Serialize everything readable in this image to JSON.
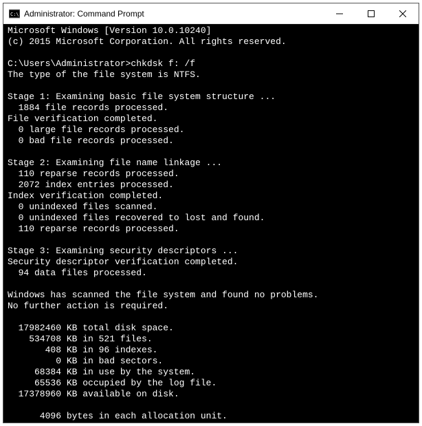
{
  "titlebar": {
    "title": "Administrator: Command Prompt"
  },
  "console": {
    "lines": [
      "Microsoft Windows [Version 10.0.10240]",
      "(c) 2015 Microsoft Corporation. All rights reserved.",
      "",
      "C:\\Users\\Administrator>chkdsk f: /f",
      "The type of the file system is NTFS.",
      "",
      "Stage 1: Examining basic file system structure ...",
      "  1884 file records processed.",
      "File verification completed.",
      "  0 large file records processed.",
      "  0 bad file records processed.",
      "",
      "Stage 2: Examining file name linkage ...",
      "  110 reparse records processed.",
      "  2072 index entries processed.",
      "Index verification completed.",
      "  0 unindexed files scanned.",
      "  0 unindexed files recovered to lost and found.",
      "  110 reparse records processed.",
      "",
      "Stage 3: Examining security descriptors ...",
      "Security descriptor verification completed.",
      "  94 data files processed.",
      "",
      "Windows has scanned the file system and found no problems.",
      "No further action is required.",
      "",
      "  17982460 KB total disk space.",
      "    534708 KB in 521 files.",
      "       408 KB in 96 indexes.",
      "         0 KB in bad sectors.",
      "     68384 KB in use by the system.",
      "     65536 KB occupied by the log file.",
      "  17378960 KB available on disk.",
      "",
      "      4096 bytes in each allocation unit."
    ]
  }
}
